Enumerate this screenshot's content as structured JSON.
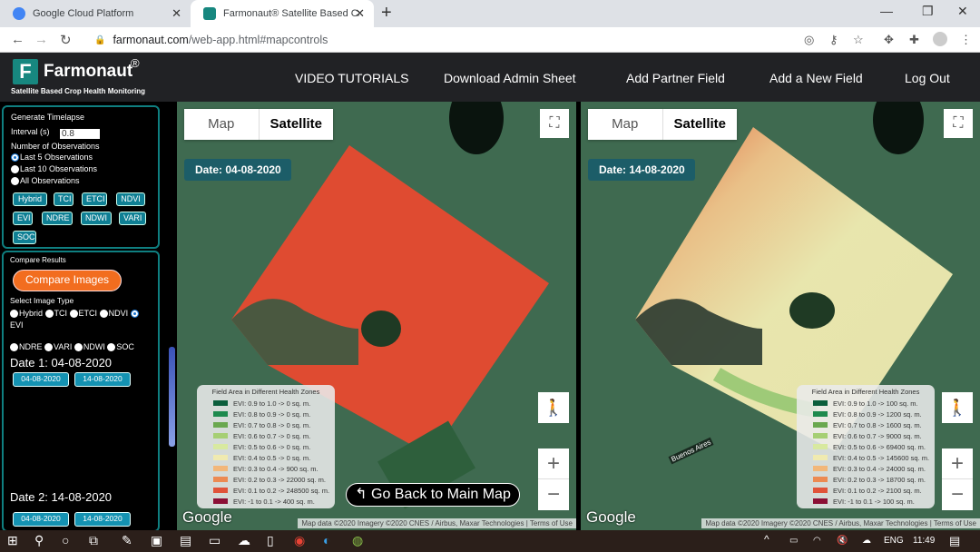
{
  "browser": {
    "tabs": [
      {
        "title": "Google Cloud Platform",
        "active": false
      },
      {
        "title": "Farmonaut® Satellite Based Crop",
        "active": true
      }
    ],
    "url_host": "farmonaut.com",
    "url_path": "/web-app.html#mapcontrols",
    "icons": [
      "location-icon",
      "key-icon",
      "star-icon",
      "extension-icon",
      "puzzle-icon",
      "profile-icon",
      "menu-icon"
    ]
  },
  "header": {
    "brand": "Farmonaut",
    "reg": "®",
    "logo_letter": "F",
    "tagline": "Satellite Based Crop Health Monitoring",
    "menu": [
      "VIDEO TUTORIALS",
      "Download Admin Sheet",
      "Add Partner Field",
      "Add a New Field",
      "Log Out"
    ]
  },
  "sidebar": {
    "timelapse": {
      "title": "Generate Timelapse",
      "interval_label": "Interval (s)",
      "interval_value": "0.8",
      "obs_label": "Number of Observations",
      "observations": [
        {
          "label": "Last 5 Observations",
          "selected": true
        },
        {
          "label": "Last 10 Observations",
          "selected": false
        },
        {
          "label": "All Observations",
          "selected": false
        }
      ],
      "layers": [
        "Hybrid",
        "TCI",
        "ETCI",
        "NDVI",
        "EVI",
        "NDRE",
        "NDWI",
        "VARI",
        "SOC"
      ]
    },
    "compare": {
      "title": "Compare Results",
      "button": "Compare Images",
      "type_label": "Select Image Type",
      "types_row1": [
        "Hybrid",
        "TCI",
        "ETCI",
        "NDVI"
      ],
      "selected_type": "EVI",
      "types_row2": [
        "NDRE",
        "VARI",
        "NDWI",
        "SOC"
      ],
      "date1_label": "Date 1: 04-08-2020",
      "date2_label": "Date 2: 14-08-2020",
      "dates": [
        "04-08-2020",
        "14-08-2020"
      ]
    }
  },
  "maps": [
    {
      "map_label": "Map",
      "satellite_label": "Satellite",
      "date": "Date:  04-08-2020",
      "legend_title": "Field Area in Different Health Zones",
      "legend": [
        {
          "label": "EVI: 0.9 to 1.0 -> 0 sq. m.",
          "color": "#0b5e3c"
        },
        {
          "label": "EVI: 0.8 to 0.9 -> 0 sq. m.",
          "color": "#1e8a4e"
        },
        {
          "label": "EVI: 0.7 to 0.8 -> 0 sq. m.",
          "color": "#6aa84f"
        },
        {
          "label": "EVI: 0.6 to 0.7 -> 0 sq. m.",
          "color": "#a6cf74"
        },
        {
          "label": "EVI: 0.5 to 0.6 -> 0 sq. m.",
          "color": "#d8e9a0"
        },
        {
          "label": "EVI: 0.4 to 0.5 -> 0 sq. m.",
          "color": "#f0eab0"
        },
        {
          "label": "EVI: 0.3 to 0.4 -> 900 sq. m.",
          "color": "#f2b77a"
        },
        {
          "label": "EVI: 0.2 to 0.3 -> 22000 sq. m.",
          "color": "#ec8a52"
        },
        {
          "label": "EVI: 0.1 to 0.2 -> 248500 sq. m.",
          "color": "#e0533a"
        },
        {
          "label": "EVI: -1 to 0.1 -> 400 sq. m.",
          "color": "#8b0f35"
        }
      ],
      "google": "Google",
      "attribution": "Map data ©2020 Imagery ©2020 CNES / Airbus, Maxar Technologies",
      "terms": "Terms of Use"
    },
    {
      "map_label": "Map",
      "satellite_label": "Satellite",
      "date": "Date:  14-08-2020",
      "legend_title": "Field Area in Different Health Zones",
      "legend": [
        {
          "label": "EVI: 0.9 to 1.0 -> 100 sq. m.",
          "color": "#0b5e3c"
        },
        {
          "label": "EVI: 0.8 to 0.9 -> 1200 sq. m.",
          "color": "#1e8a4e"
        },
        {
          "label": "EVI: 0.7 to 0.8 -> 1600 sq. m.",
          "color": "#6aa84f"
        },
        {
          "label": "EVI: 0.6 to 0.7 -> 9000 sq. m.",
          "color": "#a6cf74"
        },
        {
          "label": "EVI: 0.5 to 0.6 -> 69400 sq. m.",
          "color": "#d8e9a0"
        },
        {
          "label": "EVI: 0.4 to 0.5 -> 145600 sq. m.",
          "color": "#f0eab0"
        },
        {
          "label": "EVI: 0.3 to 0.4 -> 24000 sq. m.",
          "color": "#f2b77a"
        },
        {
          "label": "EVI: 0.2 to 0.3 -> 18700 sq. m.",
          "color": "#ec8a52"
        },
        {
          "label": "EVI: 0.1 to 0.2 -> 2100 sq. m.",
          "color": "#e0533a"
        },
        {
          "label": "EVI: -1 to 0.1 -> 100 sq. m.",
          "color": "#8b0f35"
        }
      ],
      "google": "Google",
      "attribution": "Map data ©2020 Imagery ©2020 CNES / Airbus, Maxar Technologies",
      "terms": "Terms of Use",
      "road_label": "Buenos Aires"
    }
  ],
  "go_back": "Go Back to Main Map",
  "taskbar": {
    "lang": "ENG",
    "time": "11:49"
  }
}
